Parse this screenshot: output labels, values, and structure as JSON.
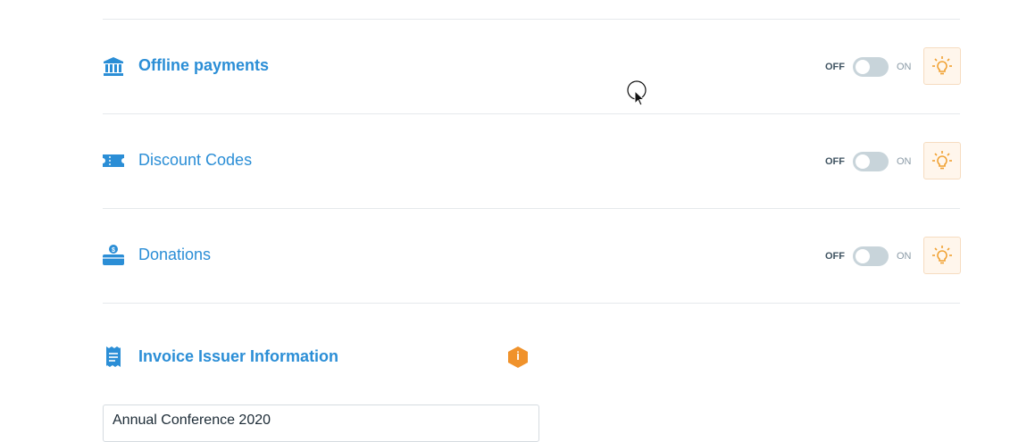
{
  "toggle_labels": {
    "off": "OFF",
    "on": "ON"
  },
  "sections": [
    {
      "title": "Offline payments",
      "icon": "bank-icon",
      "enabled": false
    },
    {
      "title": "Discount Codes",
      "icon": "ticket-icon",
      "enabled": false
    },
    {
      "title": "Donations",
      "icon": "donation-box-icon",
      "enabled": false
    }
  ],
  "invoice": {
    "title": "Invoice Issuer Information",
    "icon": "receipt-icon",
    "info_badge": "i",
    "issuer_value": "Annual Conference 2020"
  },
  "colors": {
    "title_blue": "#2b8ed6",
    "toggle_track": "#c8d4da",
    "tip_orange": "#f0a030",
    "info_orange": "#f0922b"
  }
}
